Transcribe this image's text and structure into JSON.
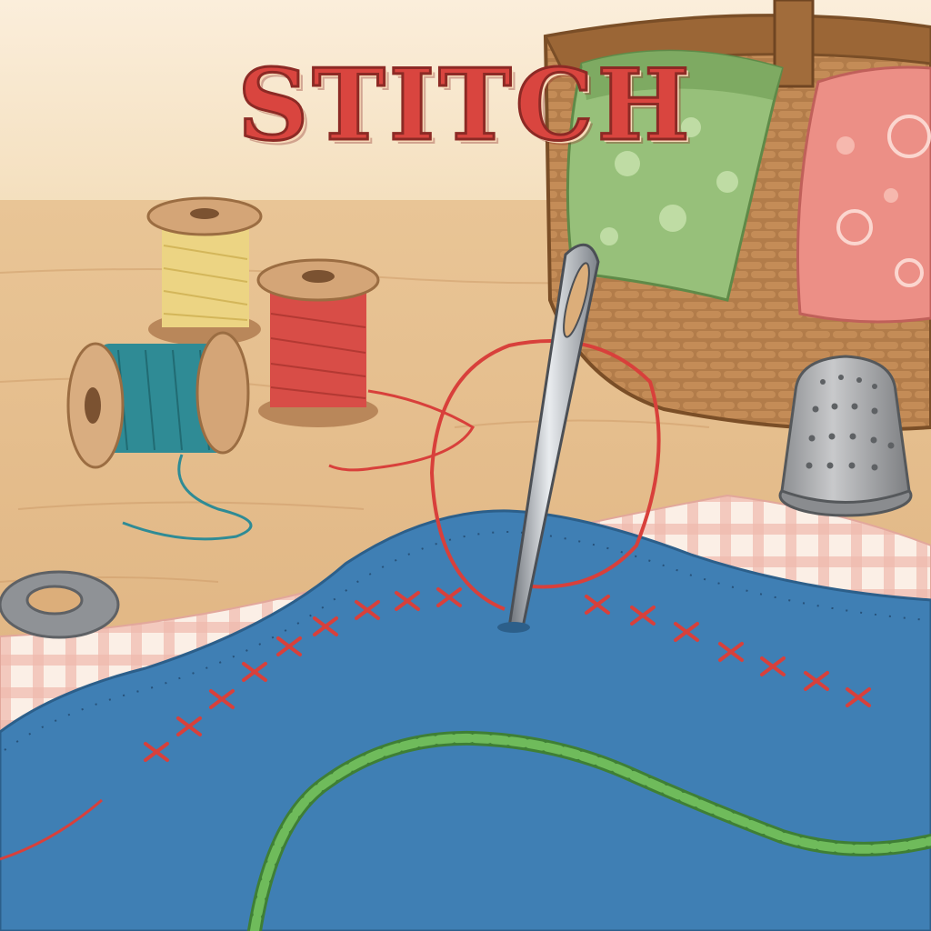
{
  "title": "STITCH",
  "colors": {
    "title_red": "#d9453f",
    "fabric_blue": "#3f7fb4",
    "thread_red": "#d8403b",
    "thread_green": "#5aa64a",
    "thread_teal": "#2f8b95",
    "thread_yellow": "#e8d27a",
    "wood": "#d8ab78",
    "wall": "#f7e7cc"
  },
  "objects": {
    "spools": [
      "yellow-thread-spool",
      "red-thread-spool",
      "teal-thread-spool"
    ],
    "tools": [
      "sewing-needle",
      "thimble",
      "washer"
    ],
    "props": [
      "wicker-basket",
      "green-floral-fabric",
      "pink-floral-fabric",
      "checkered-cloth",
      "blue-felt-fabric"
    ],
    "stitches": [
      "cross-stitch-row",
      "chain-stitch-row",
      "red-thread-loop"
    ]
  }
}
